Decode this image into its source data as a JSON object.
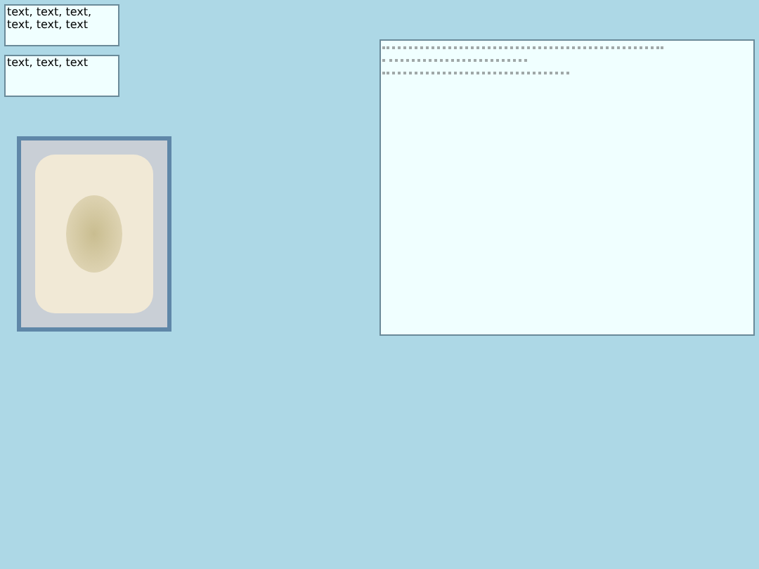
{
  "text_areas": [
    {
      "value": "text, text, text, text, text, text"
    },
    {
      "value": "text, text, text"
    }
  ]
}
